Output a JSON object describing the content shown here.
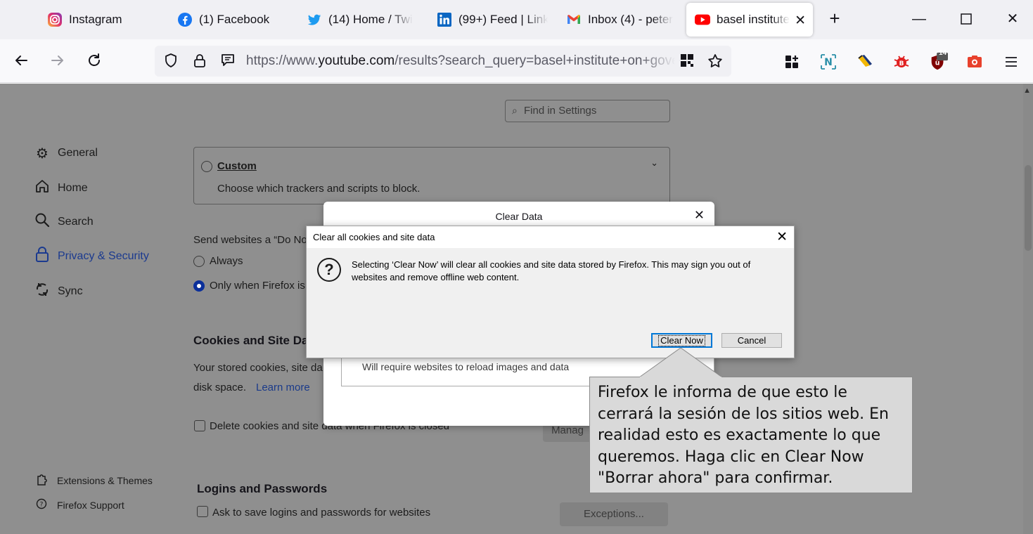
{
  "tabs": [
    {
      "title": "Instagram",
      "icon": "instagram-icon"
    },
    {
      "title": "(1) Facebook",
      "icon": "facebook-icon"
    },
    {
      "title": "(14) Home / Twi",
      "icon": "twitter-icon"
    },
    {
      "title": "(99+) Feed | Link",
      "icon": "linkedin-icon"
    },
    {
      "title": "Inbox (4) - peter",
      "icon": "gmail-icon"
    },
    {
      "title": "basel institute",
      "icon": "youtube-icon",
      "active": true
    }
  ],
  "window_controls": {
    "minimize": "—",
    "maximize": "☐",
    "close": "✕"
  },
  "url": {
    "prefix": "https://www.",
    "domain": "youtube.com",
    "rest": "/results?search_query=basel+institute+on+governance"
  },
  "extensions": {
    "badge_count": "14"
  },
  "settings": {
    "find_placeholder": "Find in Settings",
    "categories": [
      {
        "label": "General",
        "icon": "gear-icon"
      },
      {
        "label": "Home",
        "icon": "home-icon"
      },
      {
        "label": "Search",
        "icon": "search-icon"
      },
      {
        "label": "Privacy & Security",
        "icon": "lock-icon",
        "selected": true
      },
      {
        "label": "Sync",
        "icon": "sync-icon"
      }
    ],
    "footer": [
      {
        "label": "Extensions & Themes",
        "icon": "puzzle-icon"
      },
      {
        "label": "Firefox Support",
        "icon": "help-icon"
      }
    ],
    "custom": {
      "label": "Custom",
      "desc": "Choose which trackers and scripts to block."
    },
    "dnt": {
      "label": "Send websites a “Do No",
      "always": "Always",
      "only_when": "Only when Firefox is"
    },
    "cookies": {
      "heading": "Cookies and Site Da",
      "desc1": "Your stored cookies, site da",
      "desc2": "disk space.",
      "learn_more": "Learn more",
      "delete_label": "Delete cookies and site data when Firefox is closed",
      "manage_button": "Manag"
    },
    "logins": {
      "heading": "Logins and Passwords",
      "ask_label": "Ask to save logins and passwords for websites",
      "exceptions_button": "Exceptions..."
    }
  },
  "clear_data_dialog": {
    "title": "Clear Data",
    "cache_text": "Will require websites to reload images and data"
  },
  "confirm_dialog": {
    "title": "Clear all cookies and site data",
    "message": "Selecting ‘Clear Now’ will clear all cookies and site data stored by Firefox. This may sign you out of websites and remove offline web content.",
    "clear_now": "Clear Now",
    "cancel": "Cancel"
  },
  "callout": {
    "text": "Firefox le informa de que esto le cerrará la sesión de los sitios web. En realidad esto es exactamente lo que queremos. Haga clic en Clear Now \"Borrar ahora\" para confirmar."
  }
}
